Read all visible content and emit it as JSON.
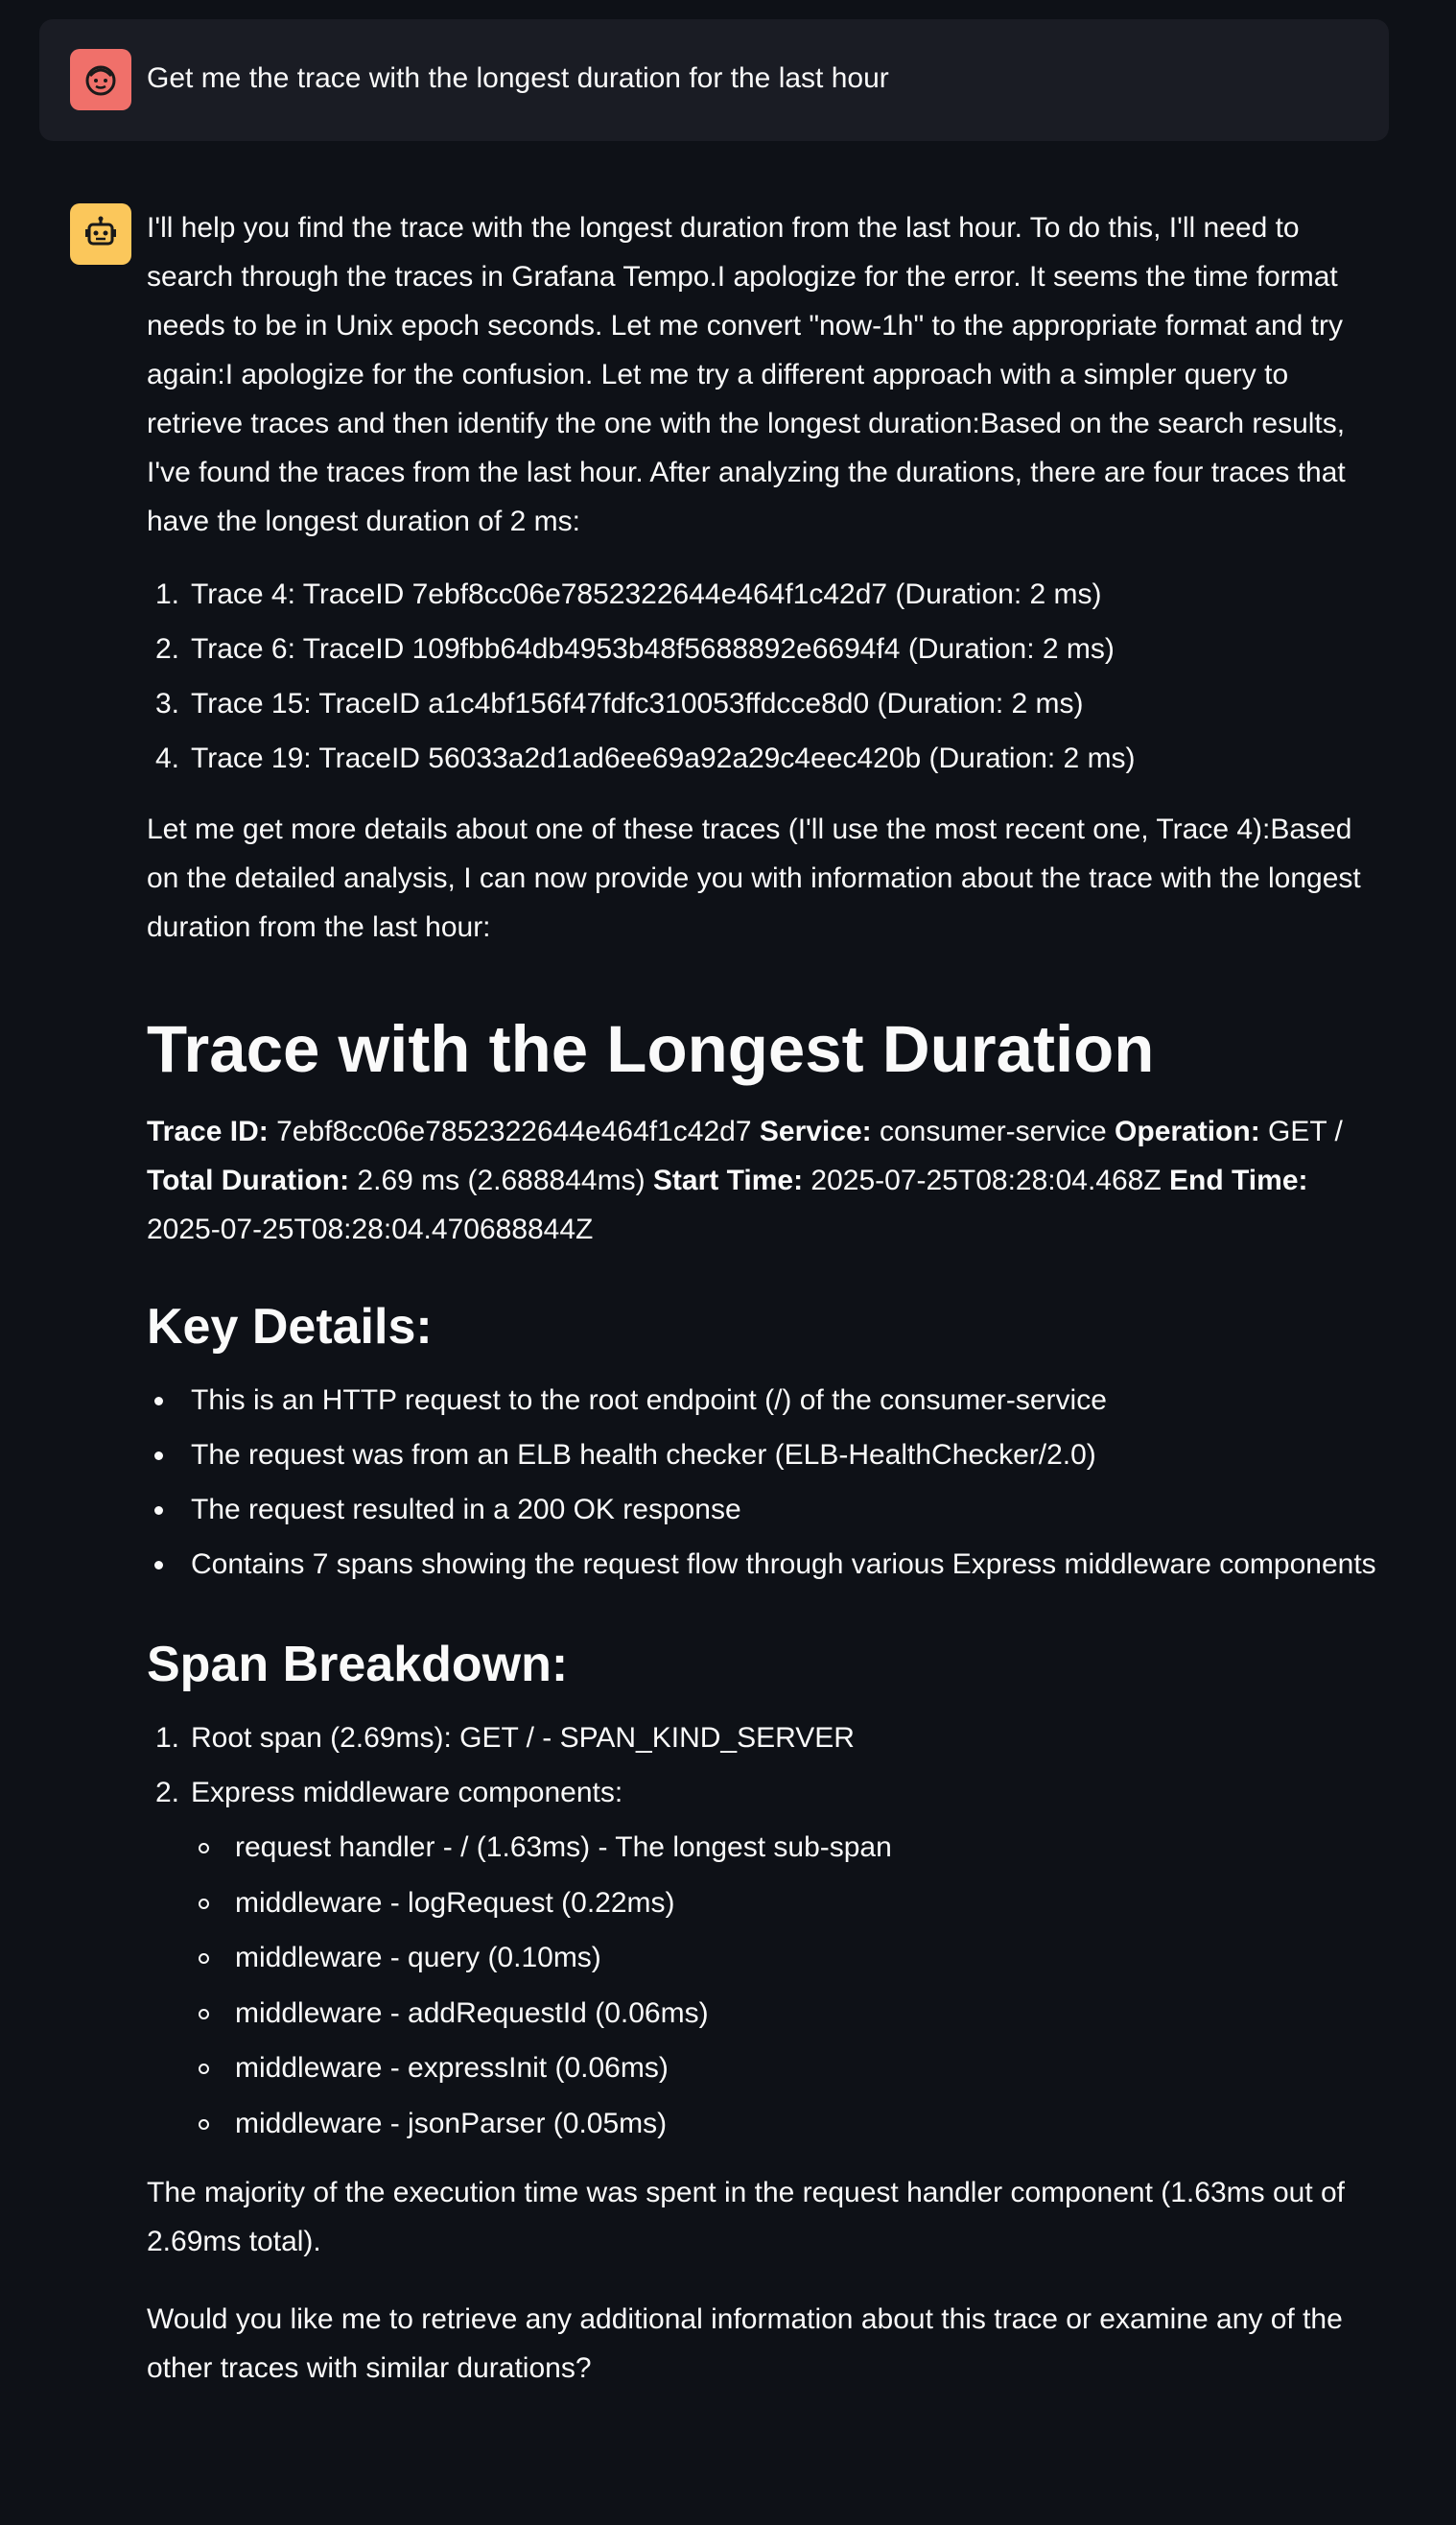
{
  "user_message": {
    "text": "Get me the trace with the longest duration for the last hour",
    "avatar_icon": "user-face-icon",
    "avatar_color": "#f0706a"
  },
  "assistant": {
    "avatar_icon": "robot-icon",
    "avatar_color": "#fbc75b",
    "intro": "I'll help you find the trace with the longest duration from the last hour. To do this, I'll need to search through the traces in Grafana Tempo.I apologize for the error. It seems the time format needs to be in Unix epoch seconds. Let me convert \"now-1h\" to the appropriate format and try again:I apologize for the confusion. Let me try a different approach with a simpler query to retrieve traces and then identify the one with the longest duration:Based on the search results, I've found the traces from the last hour. After analyzing the durations, there are four traces that have the longest duration of 2 ms:",
    "traces": [
      {
        "num": "1.",
        "text": "Trace 4: TraceID 7ebf8cc06e7852322644e464f1c42d7 (Duration: 2 ms)"
      },
      {
        "num": "2.",
        "text": "Trace 6: TraceID 109fbb64db4953b48f5688892e6694f4 (Duration: 2 ms)"
      },
      {
        "num": "3.",
        "text": "Trace 15: TraceID a1c4bf156f47fdfc310053ffdcce8d0 (Duration: 2 ms)"
      },
      {
        "num": "4.",
        "text": "Trace 19: TraceID 56033a2d1ad6ee69a92a29c4eec420b (Duration: 2 ms)"
      }
    ],
    "followup": "Let me get more details about one of these traces (I'll use the most recent one, Trace 4):Based on the detailed analysis, I can now provide you with information about the trace with the longest duration from the last hour:",
    "heading": "Trace with the Longest Duration",
    "summary": {
      "trace_id_label": "Trace ID:",
      "trace_id": " 7ebf8cc06e7852322644e464f1c42d7 ",
      "service_label": "Service:",
      "service": " consumer-service ",
      "operation_label": "Operation:",
      "operation": " GET / ",
      "total_duration_label": "Total Duration:",
      "total_duration": " 2.69 ms (2.688844ms) ",
      "start_time_label": "Start Time:",
      "start_time": " 2025-07-25T08:28:04.468Z ",
      "end_time_label": "End Time:",
      "end_time": " 2025-07-25T08:28:04.470688844Z"
    },
    "key_details_heading": "Key Details:",
    "key_details": [
      "This is an HTTP request to the root endpoint (/) of the consumer-service",
      "The request was from an ELB health checker (ELB-HealthChecker/2.0)",
      "The request resulted in a 200 OK response",
      "Contains 7 spans showing the request flow through various Express middleware components"
    ],
    "span_heading": "Span Breakdown:",
    "span_items": [
      {
        "num": "1.",
        "text": "Root span (2.69ms): GET / - SPAN_KIND_SERVER"
      },
      {
        "num": "2.",
        "text": "Express middleware components:"
      }
    ],
    "middleware": [
      "request handler - / (1.63ms) - The longest sub-span",
      "middleware - logRequest (0.22ms)",
      "middleware - query (0.10ms)",
      "middleware - addRequestId (0.06ms)",
      "middleware - expressInit (0.06ms)",
      "middleware - jsonParser (0.05ms)"
    ],
    "conclusion": "The majority of the execution time was spent in the request handler component (1.63ms out of 2.69ms total).",
    "question": "Would you like me to retrieve any additional information about this trace or examine any of the other traces with similar durations?"
  }
}
